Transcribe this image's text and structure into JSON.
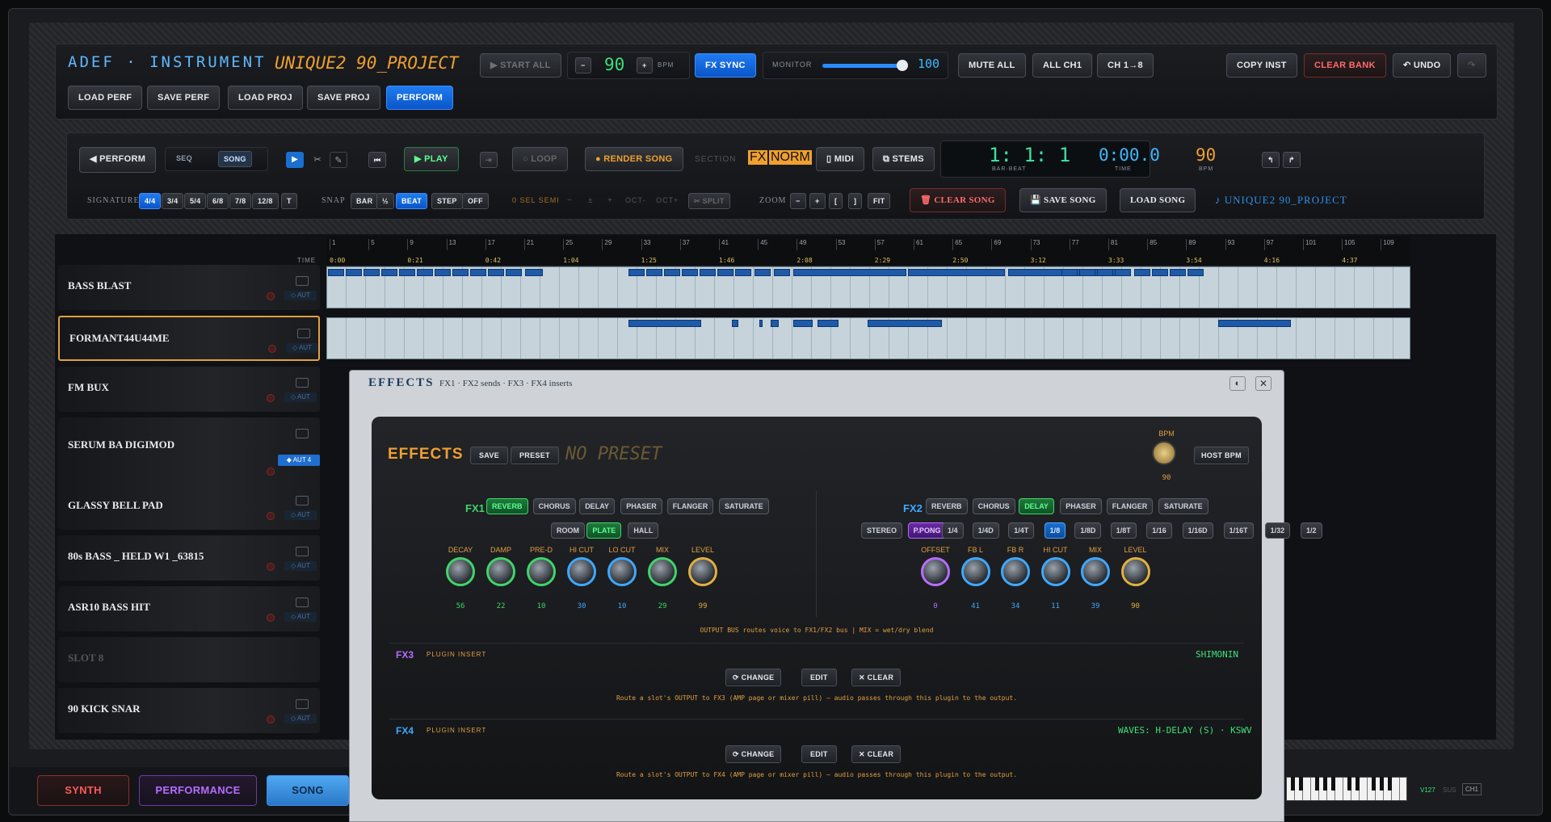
{
  "colors": {
    "accent_blue": "#0a55c8",
    "lcd_cyan": "#3fe0c8",
    "amber": "#f0a030",
    "fx_green": "#3fd56a",
    "purple": "#b66dff",
    "red": "#ff6b6b"
  },
  "header": {
    "app_title": "ADEF · INSTRUMENT",
    "project": "UNIQUE2 90_PROJECT",
    "start_all": "▶ START ALL",
    "minus": "−",
    "bpm": "90",
    "plus": "+",
    "bpm_label": "BPM",
    "fx_sync": "FX SYNC",
    "monitor_label": "MONITOR",
    "monitor_value": "100",
    "mute_all": "MUTE ALL",
    "all_ch1": "ALL CH1",
    "ch1to8": "CH 1→8",
    "copy_inst": "COPY INST",
    "clear_bank": "CLEAR BANK",
    "undo": "↶ UNDO",
    "redo": "↷",
    "load_perf": "LOAD PERF",
    "save_perf": "SAVE PERF",
    "load_proj": "LOAD PROJ",
    "save_proj": "SAVE PROJ",
    "perform": "PERFORM"
  },
  "transport": {
    "perform": "◀ PERFORM",
    "seq": "SEQ",
    "song": "SONG",
    "rewind": "⏮",
    "play": "▶ PLAY",
    "end": "⇥",
    "loop": "○ LOOP",
    "render_song": "● RENDER SONG",
    "section": "SECTION",
    "fx": "FX",
    "norm": "NORM",
    "midi": "▯ MIDI",
    "stems": "⧉ STEMS",
    "bar_beat": "1: 1: 1",
    "bar_beat_label": "BAR·BEAT",
    "time": "0:00.0",
    "time_label": "TIME",
    "bpm": "90",
    "bpm_label": "BPM",
    "signature_label": "SIGNATURE",
    "signatures": [
      "4/4",
      "3/4",
      "5/4",
      "6/8",
      "7/8",
      "12/8",
      "T"
    ],
    "snap_label": "SNAP",
    "snaps": [
      "BAR",
      "½",
      "BEAT",
      "STEP",
      "OFF"
    ],
    "sel": "0 SEL SEMI",
    "minus": "−",
    "pm": "±",
    "plus": "+",
    "oct_minus": "OCT-",
    "oct_plus": "OCT+",
    "split": "✂ SPLIT",
    "zoom_label": "ZOOM",
    "zoom_minus": "−",
    "zoom_plus": "+",
    "zoom_left": "[",
    "zoom_right": "]",
    "fit": "FIT",
    "clear_song": "🗑 CLEAR SONG",
    "save_song": "💾 SAVE SONG",
    "load_song": "LOAD SONG",
    "song_name": "♪ UNIQUE2 90_PROJECT"
  },
  "timeline": {
    "time_label": "TIME",
    "bars": [
      "1",
      "5",
      "9",
      "13",
      "17",
      "21",
      "25",
      "29",
      "33",
      "37",
      "41",
      "45",
      "49",
      "53",
      "57",
      "61",
      "65",
      "69",
      "73",
      "77",
      "81",
      "85",
      "89",
      "93",
      "97",
      "101",
      "105",
      "109"
    ],
    "times": [
      "0:00",
      "0:21",
      "0:42",
      "1:04",
      "1:25",
      "1:46",
      "2:08",
      "2:29",
      "2:50",
      "3:12",
      "3:33",
      "3:54",
      "4:16",
      "4:37"
    ]
  },
  "tracks": [
    {
      "name": "BASS BLAST",
      "aut": "◇ AUT"
    },
    {
      "name": "FORMANT44U44ME",
      "aut": "◇ AUT"
    },
    {
      "name": "FM BUX",
      "aut": "◇ AUT"
    },
    {
      "name": "SERUM BA DIGIMOD",
      "aut": "◆ AUT 4"
    },
    {
      "name": "GLASSY BELL PAD",
      "aut": "◇ AUT"
    },
    {
      "name": "80s BASS _ HELD W1 _63815",
      "aut": "◇ AUT"
    },
    {
      "name": "ASR10 BASS HIT",
      "aut": "◇ AUT"
    },
    {
      "name": "SLOT 8",
      "aut": ""
    },
    {
      "name": "90 KICK SNAR",
      "aut": "◇ AUT"
    }
  ],
  "effects": {
    "window_title": "EFFECTS",
    "window_sub": "FX1 · FX2 sends · FX3 · FX4 inserts",
    "heading": "EFFECTS",
    "save": "SAVE",
    "preset": "PRESET",
    "preset_name": "NO PRESET",
    "bpm_label": "BPM",
    "bpm_value": "90",
    "host_bpm": "HOST BPM",
    "fx1": {
      "label": "FX1",
      "types": [
        "REVERB",
        "CHORUS",
        "DELAY",
        "PHASER",
        "FLANGER",
        "SATURATE"
      ],
      "modes": [
        "ROOM",
        "PLATE",
        "HALL"
      ],
      "knobs": [
        {
          "label": "DECAY",
          "value": "56"
        },
        {
          "label": "DAMP",
          "value": "22"
        },
        {
          "label": "PRE-D",
          "value": "10"
        },
        {
          "label": "HI CUT",
          "value": "30"
        },
        {
          "label": "LO CUT",
          "value": "10"
        },
        {
          "label": "MIX",
          "value": "29"
        },
        {
          "label": "LEVEL",
          "value": "99"
        }
      ]
    },
    "fx2": {
      "label": "FX2",
      "types": [
        "REVERB",
        "CHORUS",
        "DELAY",
        "PHASER",
        "FLANGER",
        "SATURATE"
      ],
      "modes": [
        "STEREO",
        "P.PONG"
      ],
      "divs": [
        "1/4",
        "1/4D",
        "1/4T",
        "1/8",
        "1/8D",
        "1/8T",
        "1/16",
        "1/16D",
        "1/16T",
        "1/32",
        "1/2"
      ],
      "knobs": [
        {
          "label": "OFFSET",
          "value": "0"
        },
        {
          "label": "FB L",
          "value": "41"
        },
        {
          "label": "FB R",
          "value": "34"
        },
        {
          "label": "HI CUT",
          "value": "11"
        },
        {
          "label": "MIX",
          "value": "39"
        },
        {
          "label": "LEVEL",
          "value": "90"
        }
      ]
    },
    "note": "OUTPUT BUS routes voice to FX1/FX2 bus  |  MIX = wet/dry blend",
    "fx3": {
      "label": "FX3",
      "sub": "PLUGIN INSERT",
      "plugin": "SHIMONIN",
      "change": "⟳ CHANGE",
      "edit": "EDIT",
      "clear": "✕ CLEAR",
      "hint": "Route a slot's OUTPUT to FX3 (AMP page or mixer pill) — audio passes through this plugin to the output."
    },
    "fx4": {
      "label": "FX4",
      "sub": "PLUGIN INSERT",
      "plugin": "WAVES: H-DELAY (S) · KSWV",
      "change": "⟳ CHANGE",
      "edit": "EDIT",
      "clear": "✕ CLEAR",
      "hint": "Route a slot's OUTPUT to FX4 (AMP page or mixer pill) — audio passes through this plugin to the output."
    }
  },
  "bottom": {
    "synth": "SYNTH",
    "performance": "PERFORMANCE",
    "song": "SONG",
    "vel": "V127",
    "sus": "SUS",
    "ch": "CH1"
  }
}
